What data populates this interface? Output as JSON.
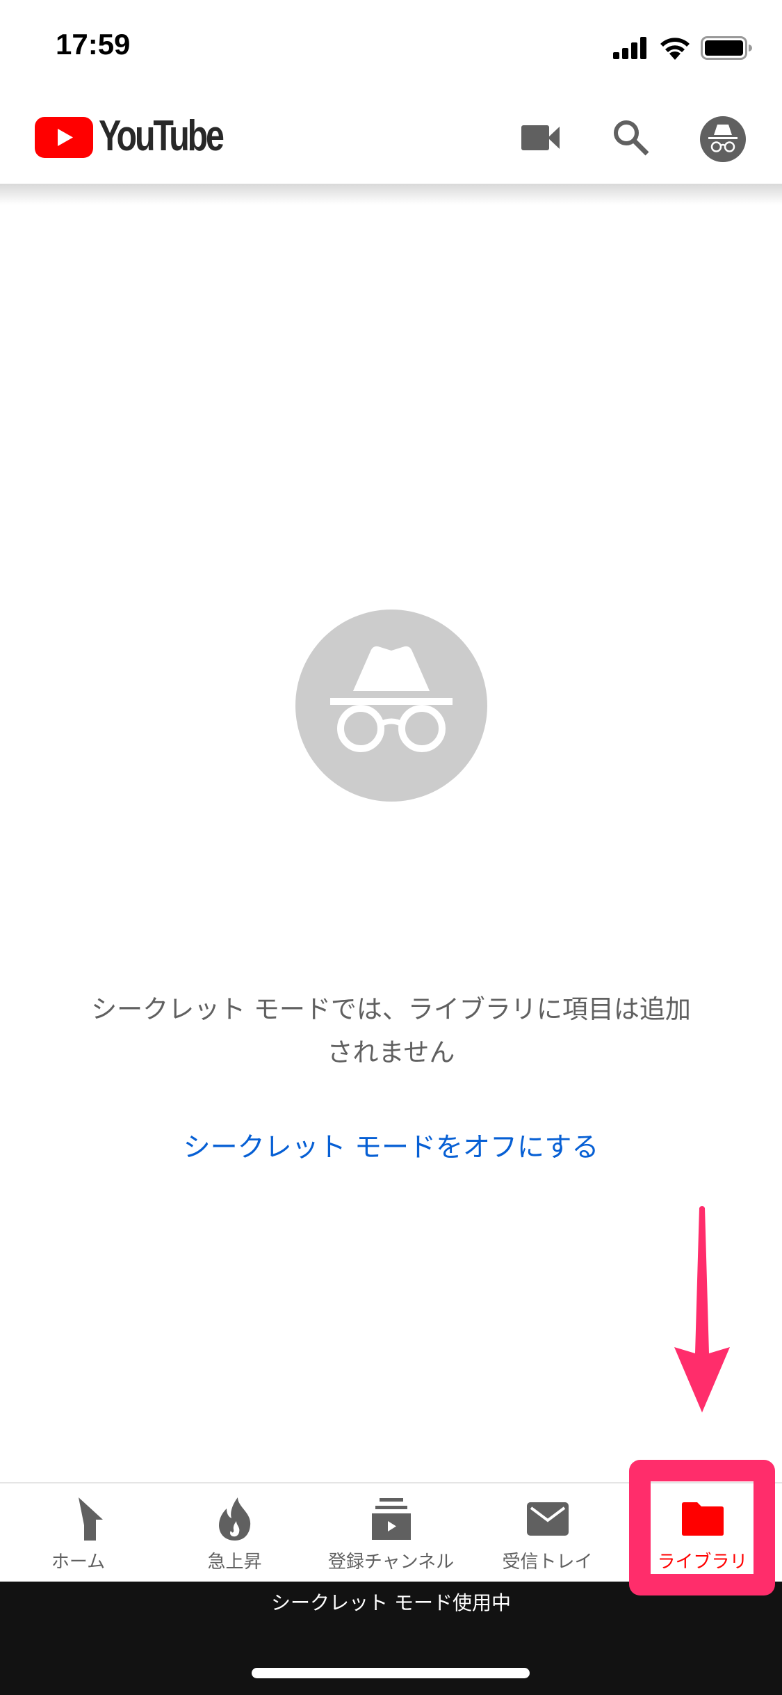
{
  "status_bar": {
    "time": "17:59",
    "icons": [
      "cellular-signal-icon",
      "wifi-icon",
      "battery-icon"
    ]
  },
  "header": {
    "logo_text": "YouTube",
    "actions": [
      {
        "name": "upload-video",
        "icon": "video-camera-icon"
      },
      {
        "name": "search",
        "icon": "search-icon"
      },
      {
        "name": "account",
        "icon": "incognito-avatar-icon"
      }
    ]
  },
  "main": {
    "hero_icon": "incognito-icon",
    "message": "シークレット モードでは、ライブラリに項目は追加されません",
    "message_line1": "シークレット モードでは、ライブラリに項目は追加",
    "message_line2": "されません",
    "turn_off_link": "シークレット モードをオフにする"
  },
  "bottom_nav": {
    "items": [
      {
        "label": "ホーム",
        "icon": "home-icon",
        "active": false
      },
      {
        "label": "急上昇",
        "icon": "trending-flame-icon",
        "active": false
      },
      {
        "label": "登録チャンネル",
        "icon": "subscriptions-icon",
        "active": false
      },
      {
        "label": "受信トレイ",
        "icon": "inbox-mail-icon",
        "active": false
      },
      {
        "label": "ライブラリ",
        "icon": "library-folder-icon",
        "active": true
      }
    ]
  },
  "incognito_bar": {
    "text": "シークレット モード使用中"
  },
  "annotation": {
    "target": "ライブラリ",
    "color": "#ff2d6b"
  },
  "colors": {
    "brand_red": "#ff0000",
    "link_blue": "#065fd4",
    "icon_gray": "#606060",
    "annotation_pink": "#ff2d6b"
  }
}
